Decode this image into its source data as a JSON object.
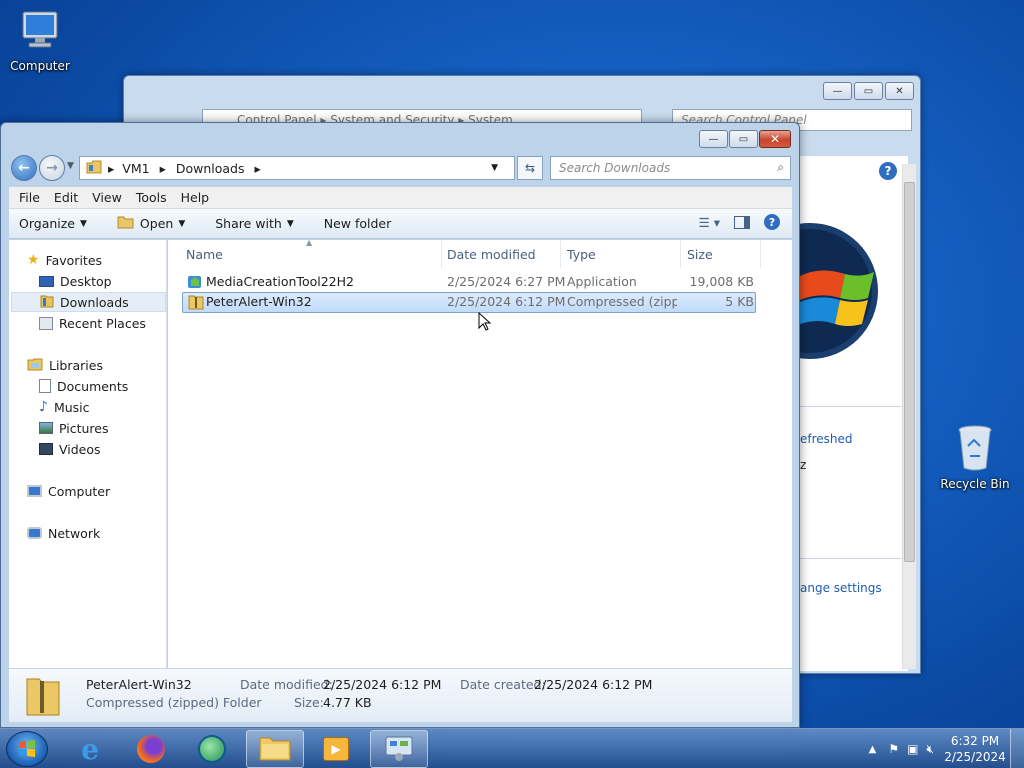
{
  "desktop": {
    "computer_label": "Computer",
    "recycle_label": "Recycle Bin"
  },
  "control_panel": {
    "breadcrumb": [
      "Control Panel",
      "System and Security",
      "System"
    ],
    "search_placeholder": "Search Control Panel",
    "link_refreshed": "efreshed",
    "text_z": "z",
    "link_change": "ange settings"
  },
  "explorer": {
    "breadcrumb": [
      "VM1",
      "Downloads"
    ],
    "search_placeholder": "Search Downloads",
    "menu": [
      "File",
      "Edit",
      "View",
      "Tools",
      "Help"
    ],
    "toolbar": {
      "organize": "Organize",
      "open": "Open",
      "share_with": "Share with",
      "new_folder": "New folder"
    },
    "nav": {
      "favorites": "Favorites",
      "desktop": "Desktop",
      "downloads": "Downloads",
      "recent_places": "Recent Places",
      "libraries": "Libraries",
      "documents": "Documents",
      "music": "Music",
      "pictures": "Pictures",
      "videos": "Videos",
      "computer": "Computer",
      "network": "Network"
    },
    "columns": {
      "name": "Name",
      "date_modified": "Date modified",
      "type": "Type",
      "size": "Size"
    },
    "files": [
      {
        "name": "MediaCreationTool22H2",
        "date": "2/25/2024 6:27 PM",
        "type": "Application",
        "size": "19,008 KB"
      },
      {
        "name": "PeterAlert-Win32",
        "date": "2/25/2024 6:12 PM",
        "type": "Compressed (zipp...",
        "size": "5 KB"
      }
    ],
    "details": {
      "name": "PeterAlert-Win32",
      "type": "Compressed (zipped) Folder",
      "date_modified_label": "Date modified:",
      "date_modified": "2/25/2024 6:12 PM",
      "date_created_label": "Date created:",
      "date_created": "2/25/2024 6:12 PM",
      "size_label": "Size:",
      "size": "4.77 KB"
    }
  },
  "taskbar": {
    "time": "6:32 PM",
    "date": "2/25/2024"
  }
}
